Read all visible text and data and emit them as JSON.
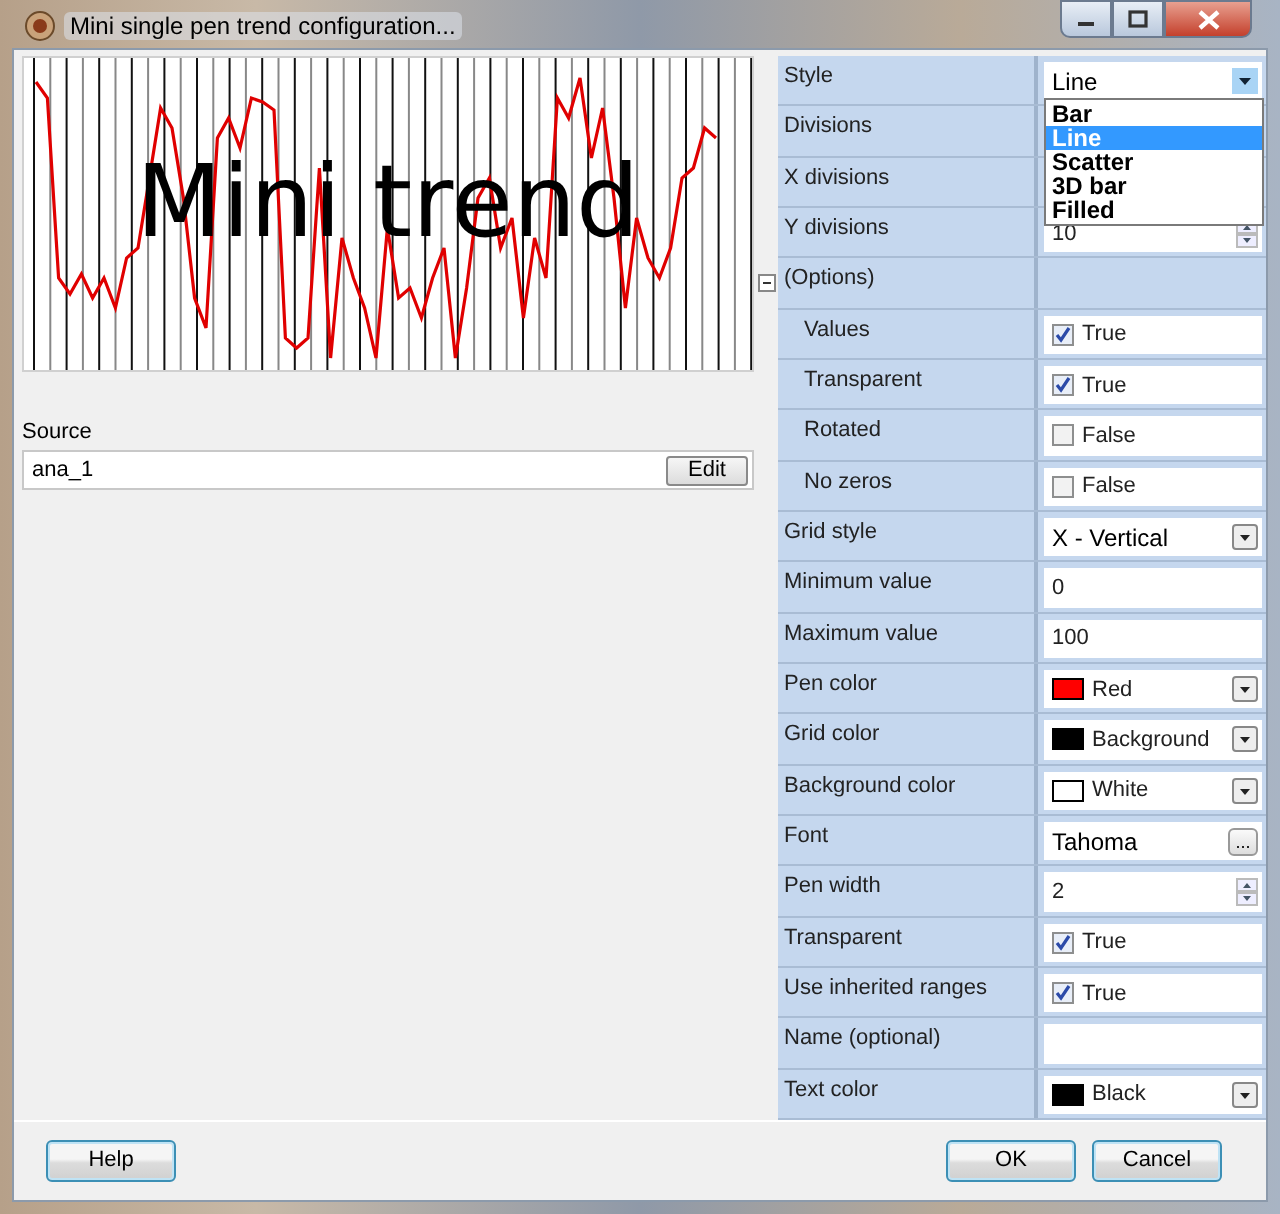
{
  "window": {
    "title": "Mini single pen trend configuration..."
  },
  "preview": {
    "title": "Mini trend"
  },
  "source": {
    "label": "Source",
    "value": "ana_1",
    "button": "Edit"
  },
  "properties": [
    {
      "label": "Style",
      "kind": "dropdown",
      "value": "Line",
      "expanded": true,
      "options": [
        {
          "label": "Bar",
          "selected": false
        },
        {
          "label": "Line",
          "selected": true
        },
        {
          "label": "Scatter",
          "selected": false
        },
        {
          "label": "3D bar",
          "selected": false
        },
        {
          "label": "Filled",
          "selected": false
        }
      ]
    },
    {
      "label": "Divisions",
      "kind": "covered"
    },
    {
      "label": "X divisions",
      "kind": "covered"
    },
    {
      "label": "Y divisions",
      "kind": "spin",
      "value": "10"
    },
    {
      "label": "(Options)",
      "kind": "group",
      "expanded": true,
      "children": [
        {
          "label": "Values",
          "kind": "checkbox",
          "checked": true,
          "value": "True"
        },
        {
          "label": "Transparent",
          "kind": "checkbox",
          "checked": true,
          "value": "True"
        },
        {
          "label": "Rotated",
          "kind": "checkbox",
          "checked": false,
          "value": "False"
        },
        {
          "label": "No zeros",
          "kind": "checkbox",
          "checked": false,
          "value": "False"
        }
      ]
    },
    {
      "label": "Grid style",
      "kind": "dropdown",
      "value": "X - Vertical",
      "expanded": false
    },
    {
      "label": "Minimum value",
      "kind": "text",
      "value": "0"
    },
    {
      "label": "Maximum value",
      "kind": "text",
      "value": "100"
    },
    {
      "label": "Pen color",
      "kind": "color",
      "color": "#ff0000",
      "value": "Red"
    },
    {
      "label": "Grid color",
      "kind": "color",
      "color": "#000000",
      "value": "Background"
    },
    {
      "label": "Background color",
      "kind": "color",
      "color": "#ffffff",
      "value": "White"
    },
    {
      "label": "Font",
      "kind": "font",
      "value": "Tahoma",
      "button": "..."
    },
    {
      "label": "Pen width",
      "kind": "spin",
      "value": "2"
    },
    {
      "label": "Transparent",
      "kind": "checkbox",
      "checked": true,
      "value": "True"
    },
    {
      "label": "Use inherited ranges",
      "kind": "checkbox",
      "checked": true,
      "value": "True"
    },
    {
      "label": "Name (optional)",
      "kind": "text"
    },
    {
      "label": "Text color",
      "kind": "color",
      "color": "#000000",
      "value": "Black"
    }
  ],
  "buttons": [
    {
      "label": "Help",
      "kind": "left"
    },
    {
      "label": "OK",
      "kind": "right"
    },
    {
      "label": "Cancel",
      "kind": "right"
    }
  ]
}
